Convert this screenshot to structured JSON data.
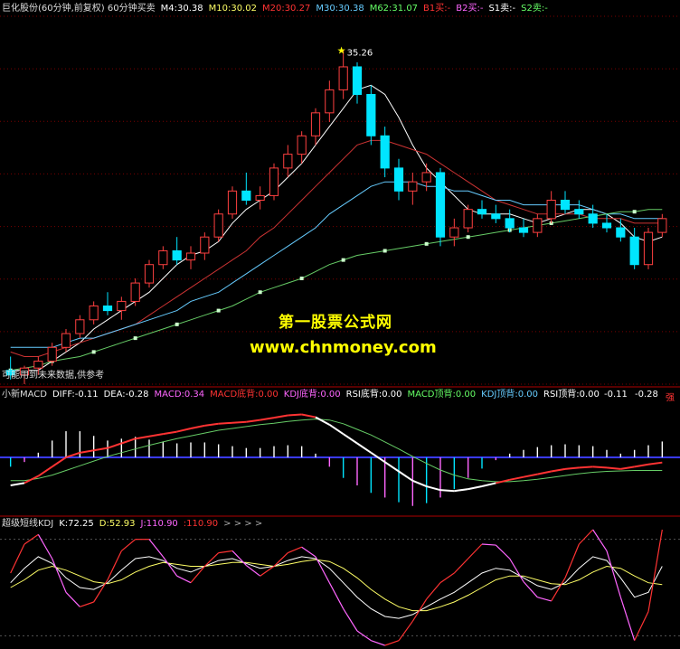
{
  "chart_data": [
    {
      "type": "candlestick",
      "title": "巨化股份(60分钟,前复权) 60分钟买卖",
      "legend": [
        {
          "text": "M4:30.38",
          "color": "#ffffff"
        },
        {
          "text": "M10:30.02",
          "color": "#ffff66"
        },
        {
          "text": "M20:30.27",
          "color": "#ff3333"
        },
        {
          "text": "M30:30.38",
          "color": "#66ccff"
        },
        {
          "text": "M62:31.07",
          "color": "#66ff66"
        },
        {
          "text": "B1买:-",
          "color": "#ff3333"
        },
        {
          "text": "B2买:-",
          "color": "#ff66ff"
        },
        {
          "text": "S1卖:-",
          "color": "#ffffff"
        },
        {
          "text": "S2卖:-",
          "color": "#66ff66"
        }
      ],
      "high_label": "35.26",
      "ylim": [
        28.0,
        36.0
      ],
      "candles": [
        [
          28.3,
          28.6,
          28.1,
          28.2
        ],
        [
          28.2,
          28.4,
          28.0,
          28.35
        ],
        [
          28.35,
          28.6,
          28.2,
          28.5
        ],
        [
          28.5,
          28.9,
          28.4,
          28.8
        ],
        [
          28.8,
          29.2,
          28.7,
          29.1
        ],
        [
          29.1,
          29.5,
          29.0,
          29.4
        ],
        [
          29.4,
          29.8,
          29.3,
          29.7
        ],
        [
          29.7,
          30.0,
          29.5,
          29.6
        ],
        [
          29.6,
          29.9,
          29.4,
          29.8
        ],
        [
          29.8,
          30.3,
          29.7,
          30.2
        ],
        [
          30.2,
          30.7,
          30.1,
          30.6
        ],
        [
          30.6,
          31.0,
          30.5,
          30.9
        ],
        [
          30.9,
          31.2,
          30.6,
          30.7
        ],
        [
          30.7,
          31.0,
          30.5,
          30.85
        ],
        [
          30.85,
          31.3,
          30.7,
          31.2
        ],
        [
          31.2,
          31.8,
          31.1,
          31.7
        ],
        [
          31.7,
          32.3,
          31.6,
          32.2
        ],
        [
          32.2,
          32.6,
          31.9,
          32.0
        ],
        [
          32.0,
          32.3,
          31.8,
          32.1
        ],
        [
          32.1,
          32.8,
          32.0,
          32.7
        ],
        [
          32.7,
          33.2,
          32.5,
          33.0
        ],
        [
          33.0,
          33.5,
          32.8,
          33.4
        ],
        [
          33.4,
          34.0,
          33.2,
          33.9
        ],
        [
          33.9,
          34.6,
          33.7,
          34.4
        ],
        [
          34.4,
          35.26,
          34.2,
          34.9
        ],
        [
          34.9,
          35.0,
          34.1,
          34.3
        ],
        [
          34.3,
          34.5,
          33.2,
          33.4
        ],
        [
          33.4,
          33.6,
          32.5,
          32.7
        ],
        [
          32.7,
          32.9,
          32.0,
          32.2
        ],
        [
          32.2,
          32.6,
          31.9,
          32.4
        ],
        [
          32.4,
          32.8,
          32.2,
          32.6
        ],
        [
          32.6,
          32.7,
          31.0,
          31.2
        ],
        [
          31.2,
          31.6,
          31.0,
          31.4
        ],
        [
          31.4,
          31.9,
          31.3,
          31.8
        ],
        [
          31.8,
          32.0,
          31.6,
          31.7
        ],
        [
          31.7,
          31.9,
          31.5,
          31.6
        ],
        [
          31.6,
          31.8,
          31.3,
          31.4
        ],
        [
          31.4,
          31.6,
          31.2,
          31.3
        ],
        [
          31.3,
          31.7,
          31.2,
          31.6
        ],
        [
          31.6,
          32.2,
          31.5,
          32.0
        ],
        [
          32.0,
          32.2,
          31.7,
          31.8
        ],
        [
          31.8,
          32.0,
          31.6,
          31.7
        ],
        [
          31.7,
          31.9,
          31.4,
          31.5
        ],
        [
          31.5,
          31.7,
          31.3,
          31.4
        ],
        [
          31.4,
          31.6,
          31.1,
          31.2
        ],
        [
          31.2,
          31.4,
          30.5,
          30.6
        ],
        [
          30.6,
          31.4,
          30.5,
          31.3
        ],
        [
          31.3,
          31.7,
          31.2,
          31.6
        ]
      ],
      "ma": [
        {
          "name": "M4",
          "color": "#ffffff",
          "values": [
            28.3,
            28.3,
            28.3,
            28.5,
            28.7,
            28.9,
            29.2,
            29.4,
            29.6,
            29.8,
            30.0,
            30.3,
            30.6,
            30.8,
            30.9,
            31.1,
            31.5,
            31.8,
            32.0,
            32.2,
            32.5,
            32.8,
            33.2,
            33.6,
            34.0,
            34.4,
            34.5,
            34.3,
            33.8,
            33.2,
            32.7,
            32.4,
            32.1,
            31.8,
            31.7,
            31.7,
            31.7,
            31.6,
            31.5,
            31.6,
            31.7,
            31.8,
            31.8,
            31.7,
            31.5,
            31.2,
            31.1,
            31.2
          ]
        },
        {
          "name": "M20",
          "color": "#cc3333",
          "values": [
            28.7,
            28.6,
            28.6,
            28.7,
            28.8,
            28.9,
            29.0,
            29.1,
            29.2,
            29.3,
            29.5,
            29.7,
            29.9,
            30.1,
            30.3,
            30.5,
            30.7,
            30.9,
            31.2,
            31.4,
            31.7,
            32.0,
            32.3,
            32.6,
            32.9,
            33.2,
            33.3,
            33.3,
            33.2,
            33.1,
            33.0,
            32.8,
            32.6,
            32.4,
            32.2,
            32.0,
            31.9,
            31.8,
            31.7,
            31.7,
            31.7,
            31.7,
            31.6,
            31.6,
            31.6,
            31.5,
            31.5,
            31.5
          ]
        },
        {
          "name": "M30",
          "color": "#66ccff",
          "values": [
            28.8,
            28.8,
            28.8,
            28.8,
            28.9,
            29.0,
            29.0,
            29.1,
            29.2,
            29.3,
            29.4,
            29.5,
            29.6,
            29.8,
            29.9,
            30.0,
            30.2,
            30.4,
            30.6,
            30.8,
            31.0,
            31.2,
            31.4,
            31.7,
            31.9,
            32.1,
            32.3,
            32.4,
            32.4,
            32.4,
            32.3,
            32.3,
            32.2,
            32.2,
            32.1,
            32.0,
            32.0,
            31.9,
            31.9,
            31.9,
            31.9,
            31.9,
            31.8,
            31.7,
            31.7,
            31.6,
            31.6,
            31.6
          ]
        },
        {
          "name": "M62",
          "color": "#66cc66",
          "values": [
            28.3,
            28.35,
            28.4,
            28.5,
            28.55,
            28.6,
            28.7,
            28.8,
            28.9,
            29.0,
            29.1,
            29.2,
            29.3,
            29.4,
            29.5,
            29.6,
            29.7,
            29.85,
            30.0,
            30.1,
            30.2,
            30.3,
            30.45,
            30.6,
            30.7,
            30.8,
            30.85,
            30.9,
            30.95,
            31.0,
            31.05,
            31.1,
            31.15,
            31.2,
            31.25,
            31.3,
            31.35,
            31.4,
            31.45,
            31.5,
            31.55,
            31.6,
            31.65,
            31.7,
            31.75,
            31.75,
            31.8,
            31.8
          ]
        }
      ]
    },
    {
      "type": "macd",
      "legend": [
        {
          "text": "小新MACD",
          "color": "#dddddd"
        },
        {
          "text": "DIFF:-0.11",
          "color": "#ffffff"
        },
        {
          "text": "DEA:-0.28",
          "color": "#ffffff"
        },
        {
          "text": "MACD:0.34",
          "color": "#ff66ff"
        },
        {
          "text": "MACD底背:0.00",
          "color": "#ff3333"
        },
        {
          "text": "KDJ底背:0.00",
          "color": "#ff66ff"
        },
        {
          "text": "RSI底背:0.00",
          "color": "#ffffff"
        },
        {
          "text": "MACD顶背:0.00",
          "color": "#66ff66"
        },
        {
          "text": "KDJ顶背:0.00",
          "color": "#66ccff"
        },
        {
          "text": "RSI顶背:0.00",
          "color": "#ffffff"
        }
      ],
      "right_labels": [
        {
          "text": "-0.11",
          "color": "#ffffff"
        },
        {
          "text": "-0.28",
          "color": "#ffffff"
        },
        {
          "text": "强",
          "color": "#ff3333"
        }
      ],
      "ylim": [
        -1.2,
        1.2
      ],
      "diff": [
        -0.6,
        -0.55,
        -0.4,
        -0.2,
        0.0,
        0.1,
        0.15,
        0.2,
        0.3,
        0.4,
        0.45,
        0.5,
        0.55,
        0.62,
        0.68,
        0.72,
        0.74,
        0.76,
        0.8,
        0.85,
        0.9,
        0.92,
        0.86,
        0.7,
        0.5,
        0.3,
        0.1,
        -0.1,
        -0.3,
        -0.5,
        -0.62,
        -0.7,
        -0.72,
        -0.68,
        -0.62,
        -0.55,
        -0.48,
        -0.42,
        -0.36,
        -0.3,
        -0.25,
        -0.22,
        -0.2,
        -0.22,
        -0.25,
        -0.2,
        -0.15,
        -0.11
      ],
      "dea": [
        -0.5,
        -0.5,
        -0.45,
        -0.38,
        -0.28,
        -0.18,
        -0.08,
        0.02,
        0.1,
        0.18,
        0.26,
        0.33,
        0.4,
        0.46,
        0.52,
        0.58,
        0.62,
        0.66,
        0.7,
        0.73,
        0.77,
        0.8,
        0.82,
        0.8,
        0.72,
        0.6,
        0.48,
        0.33,
        0.18,
        0.02,
        -0.13,
        -0.27,
        -0.38,
        -0.46,
        -0.5,
        -0.52,
        -0.52,
        -0.5,
        -0.47,
        -0.43,
        -0.39,
        -0.35,
        -0.32,
        -0.3,
        -0.29,
        -0.28,
        -0.28,
        -0.28
      ],
      "macd": [
        -0.2,
        -0.1,
        0.1,
        0.36,
        0.56,
        0.56,
        0.46,
        0.36,
        0.4,
        0.44,
        0.38,
        0.34,
        0.3,
        0.32,
        0.32,
        0.28,
        0.24,
        0.2,
        0.2,
        0.24,
        0.26,
        0.24,
        0.08,
        -0.2,
        -0.44,
        -0.6,
        -0.76,
        -0.86,
        -0.96,
        -1.04,
        -0.98,
        -0.86,
        -0.68,
        -0.44,
        -0.24,
        -0.06,
        0.08,
        0.16,
        0.22,
        0.26,
        0.28,
        0.26,
        0.24,
        0.16,
        0.08,
        0.16,
        0.26,
        0.34
      ]
    },
    {
      "type": "kdj",
      "legend": [
        {
          "text": "超级短线KDJ",
          "color": "#dddddd"
        },
        {
          "text": "K:72.25",
          "color": "#ffffff"
        },
        {
          "text": "D:52.93",
          "color": "#ffff66"
        },
        {
          "text": "J:110.90",
          "color": "#ff66ff"
        },
        {
          "text": ":110.90",
          "color": "#ff3333"
        },
        {
          "text": "> > > >",
          "color": "#aaaaaa"
        }
      ],
      "ylim": [
        -10,
        110
      ],
      "k": [
        55,
        70,
        82,
        75,
        60,
        50,
        48,
        55,
        68,
        80,
        82,
        78,
        70,
        66,
        72,
        78,
        80,
        75,
        70,
        72,
        78,
        82,
        80,
        70,
        55,
        40,
        28,
        20,
        18,
        22,
        30,
        38,
        45,
        55,
        65,
        70,
        68,
        60,
        52,
        48,
        55,
        70,
        82,
        78,
        60,
        40,
        45,
        72
      ],
      "d": [
        50,
        58,
        68,
        72,
        68,
        62,
        56,
        54,
        58,
        66,
        72,
        76,
        74,
        72,
        72,
        74,
        76,
        76,
        74,
        72,
        74,
        77,
        79,
        77,
        70,
        60,
        48,
        38,
        30,
        26,
        26,
        30,
        35,
        42,
        50,
        58,
        62,
        62,
        58,
        54,
        53,
        58,
        66,
        72,
        70,
        62,
        55,
        53
      ],
      "j": [
        65,
        95,
        105,
        80,
        45,
        30,
        35,
        58,
        88,
        100,
        100,
        82,
        62,
        55,
        72,
        86,
        88,
        73,
        62,
        72,
        86,
        92,
        82,
        55,
        28,
        5,
        -5,
        -10,
        -5,
        15,
        38,
        55,
        65,
        80,
        95,
        94,
        80,
        56,
        40,
        36,
        60,
        95,
        110,
        88,
        40,
        -5,
        25,
        110
      ]
    }
  ],
  "watermark": {
    "line1": "第一股票公式网",
    "line2": "www.chnmoney.com"
  },
  "note": "可能用到未来数据,供参考"
}
